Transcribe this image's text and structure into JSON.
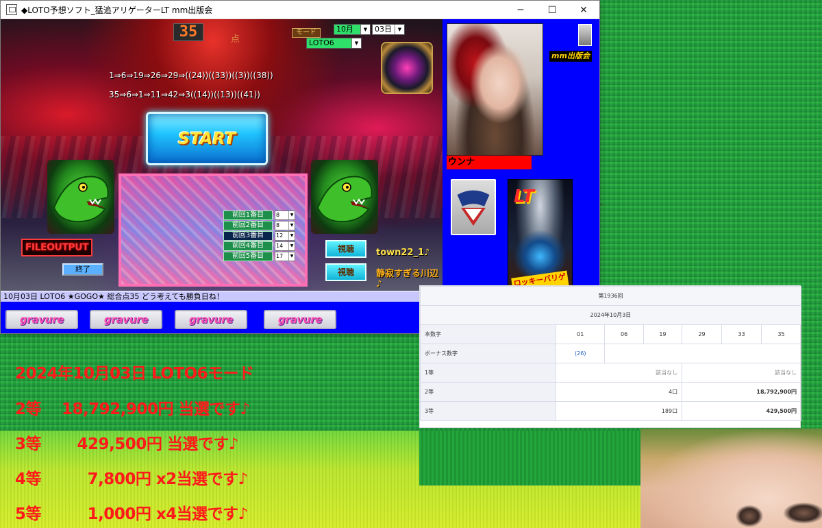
{
  "window": {
    "title": "◆LOTO予想ソフト_猛追アリゲーターLT  mm出版会",
    "controls": {
      "minimize": "─",
      "maximize": "☐",
      "close": "✕"
    }
  },
  "stage": {
    "score": "35",
    "score_unit": "点",
    "mode_label": "モード",
    "month_select": "10月",
    "day_select": "03日",
    "game_select": "LOTO6",
    "sequence_1": "1⇒6⇒19⇒26⇒29⇒((24))((33))((3))((38))",
    "sequence_2": "35⇒6⇒1⇒11⇒42⇒3((14))((13))((41))",
    "start_label": "START",
    "previous_draws": [
      {
        "label": "前回1番目",
        "value": "8"
      },
      {
        "label": "前回2番目",
        "value": "8"
      },
      {
        "label": "前回3番目",
        "value": "12"
      },
      {
        "label": "前回4番目",
        "value": "14"
      },
      {
        "label": "前回5番目",
        "value": "17"
      }
    ],
    "file_output_label": "FILEOUTPUT",
    "end_label": "終了",
    "view_label_1": "視聴",
    "view_label_2": "視聴",
    "town_text": "town22_1♪",
    "quiet_text": "静寂すぎる川辺♪",
    "status_text": "10月03日 LOTO6 ★GOGO★ 総合点35  どう考えても勝負日ね！",
    "gravure_buttons": [
      "gravure",
      "gravure",
      "gravure",
      "gravure"
    ]
  },
  "side_panel": {
    "name": "ウンナ",
    "publisher": "mm出版会",
    "poster_title": "LT",
    "poster_caption": "ロッキーバリゲー"
  },
  "results": {
    "round": "第1936回",
    "date": "2024年10月3日",
    "main_label": "本数字",
    "main_numbers": [
      "01",
      "06",
      "19",
      "29",
      "33",
      "35"
    ],
    "bonus_label": "ボーナス数字",
    "bonus_number": "(26)",
    "prizes": [
      {
        "rank": "1等",
        "count": "該当なし",
        "amount": "該当なし"
      },
      {
        "rank": "2等",
        "count": "4口",
        "amount": "18,792,900円"
      },
      {
        "rank": "3等",
        "count": "189口",
        "amount": "429,500円"
      }
    ]
  },
  "winnings": [
    "2024年10月03日 LOTO6モード",
    "2等    18,792,900円 当選です♪",
    "3等       429,500円 当選です♪",
    "4等         7,800円 x2当選です♪",
    "5等         1,000円 x4当選です♪"
  ],
  "colors": {
    "window_bg": "#0000ff",
    "win_text": "#ff1a1a",
    "name_bar": "#ff0000"
  }
}
